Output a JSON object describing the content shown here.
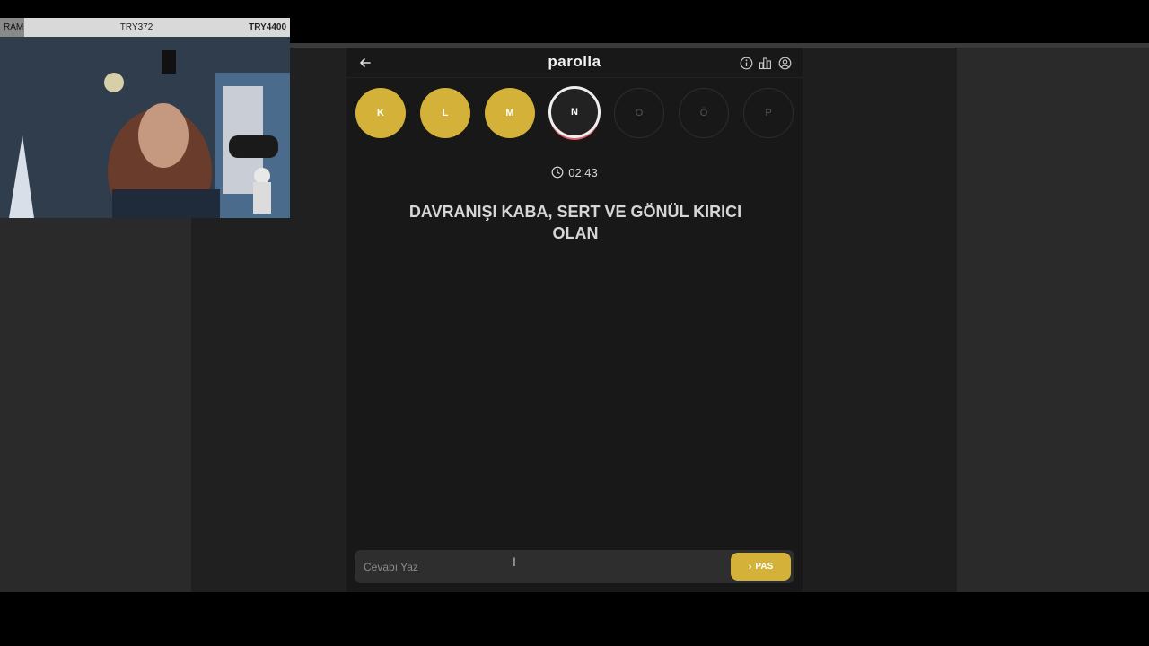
{
  "overlay": {
    "ram_label": "RAM",
    "price_mid": "TRY372",
    "price_right": "TRY4400"
  },
  "app": {
    "title": "parolla",
    "back_icon": "arrow-left-icon",
    "header_icons": [
      "info-icon",
      "stats-icon",
      "user-icon"
    ],
    "letters": [
      {
        "char": "K",
        "state": "done"
      },
      {
        "char": "L",
        "state": "done"
      },
      {
        "char": "M",
        "state": "done"
      },
      {
        "char": "N",
        "state": "current"
      },
      {
        "char": "O",
        "state": "todo"
      },
      {
        "char": "Ö",
        "state": "todo"
      },
      {
        "char": "P",
        "state": "todo"
      }
    ],
    "timer": "02:43",
    "question": "DAVRANIŞI KABA, SERT VE GÖNÜL KIRICI OLAN",
    "answer_placeholder": "Cevabı Yaz",
    "answer_value": "",
    "pass_label": "PAS"
  },
  "colors": {
    "accent": "#d4b23a",
    "background": "#181818",
    "current_ring": "#eeeeee",
    "current_shadow": "#e05a6a"
  }
}
